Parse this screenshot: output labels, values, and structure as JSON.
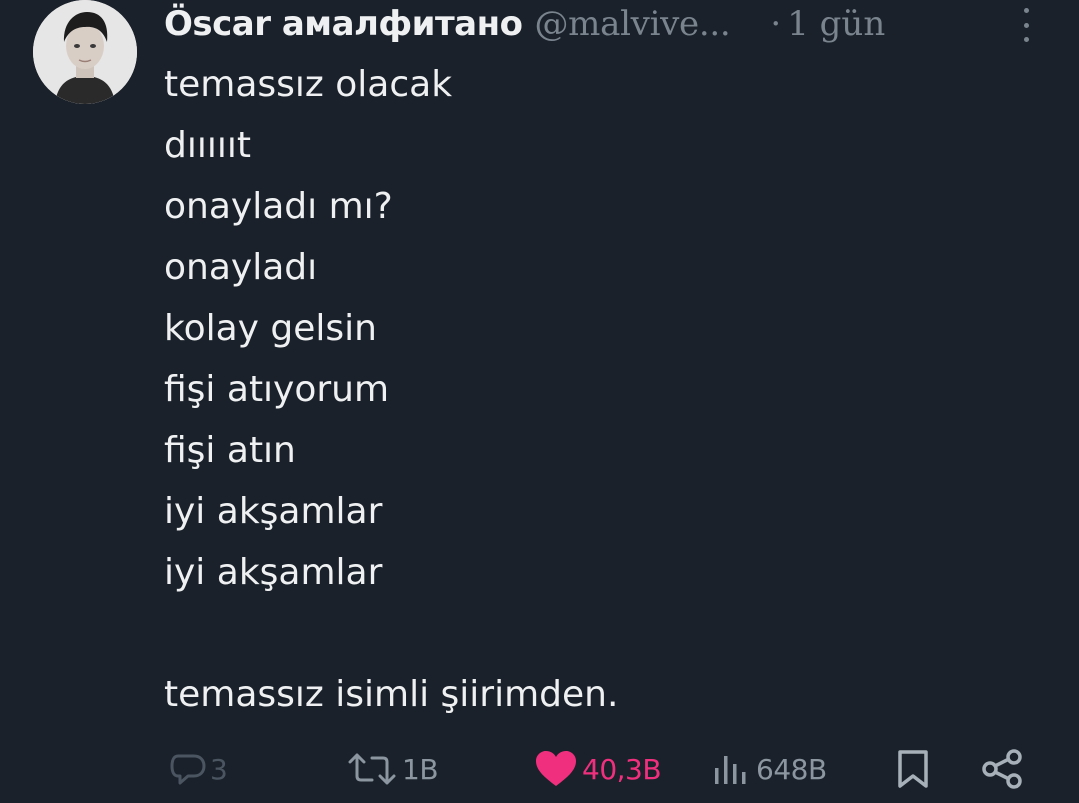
{
  "tweet": {
    "author_name": "Öscar амалфитано",
    "handle": "@malvive...",
    "separator": "·",
    "time_ago": "1 gün",
    "lines": [
      "temassız olacak",
      "dıııııt",
      "onayladı mı?",
      "onayladı",
      "kolay gelsin",
      "fişi atıyorum",
      "fişi atın",
      "iyi akşamlar",
      "iyi akşamlar"
    ],
    "closing_line": "temassız isimli şiirimden."
  },
  "actions": {
    "replies": "3",
    "retweets": "1B",
    "likes": "40,3B",
    "views": "648B"
  },
  "icons": {
    "reply": "reply-icon",
    "retweet": "retweet-icon",
    "like": "heart-icon",
    "views": "views-icon",
    "bookmark": "bookmark-icon",
    "share": "share-icon",
    "more": "more-icon"
  },
  "colors": {
    "background": "#1a212a",
    "text": "#eef0f1",
    "muted": "#7a848e",
    "like": "#f0307e"
  }
}
